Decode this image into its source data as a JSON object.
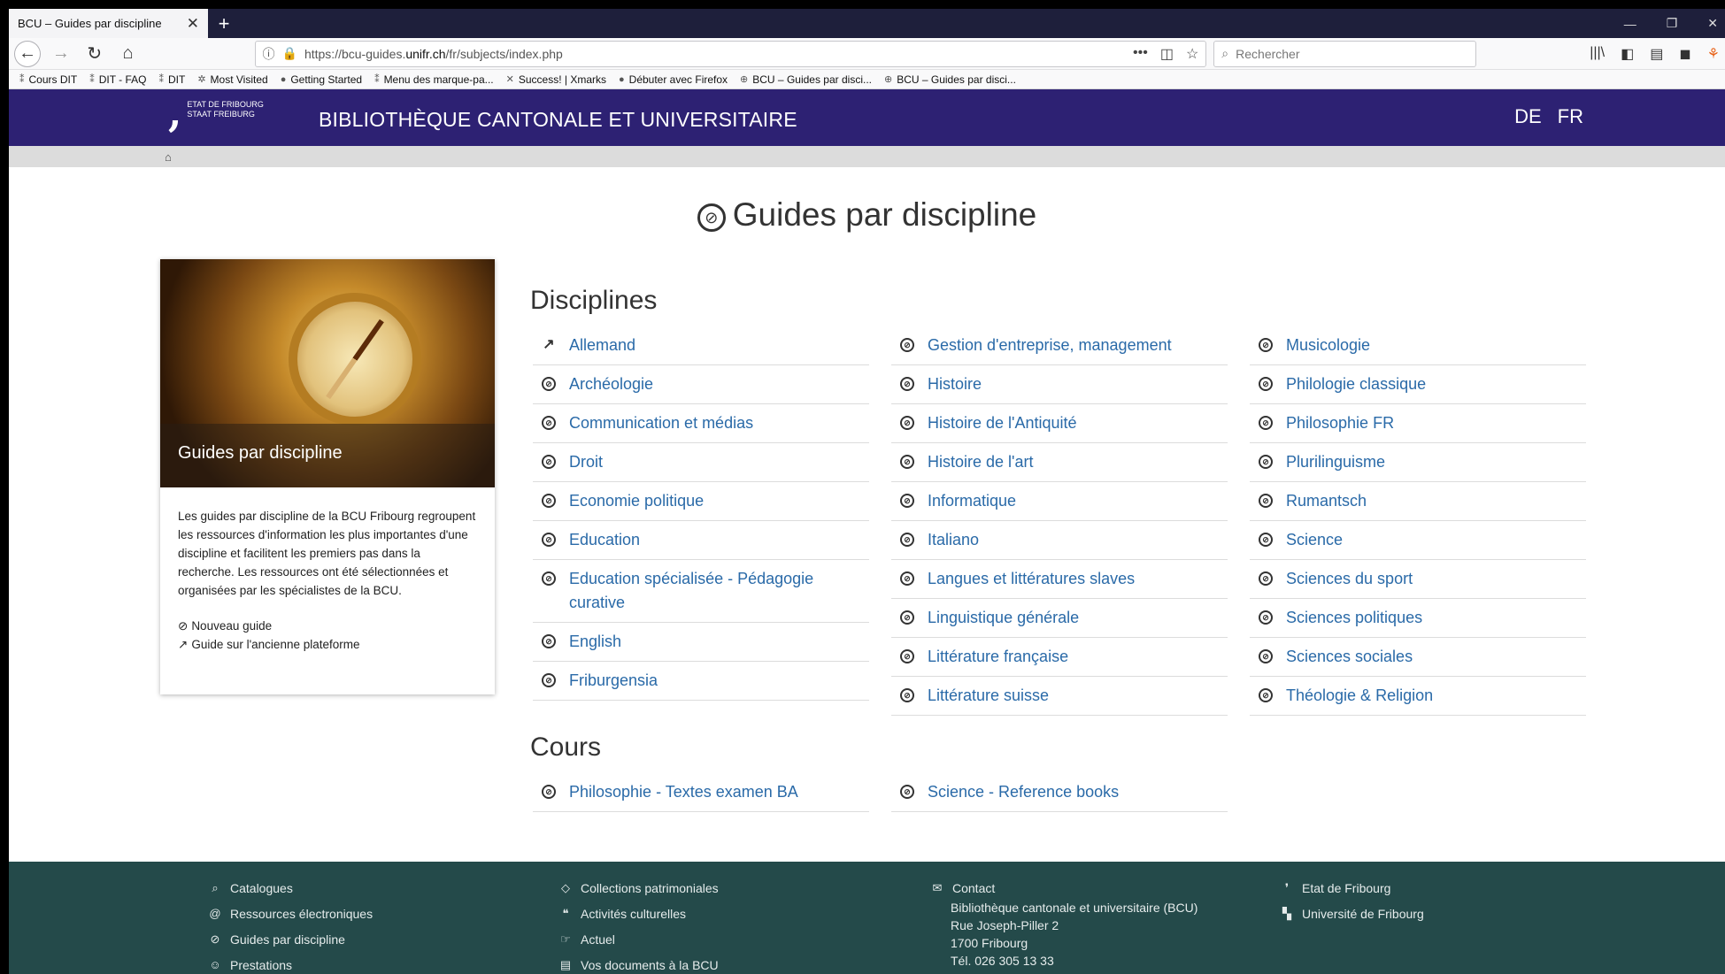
{
  "browser": {
    "tab_title": "BCU – Guides par discipline",
    "url_prefix": "https://bcu-guides.",
    "url_domain": "unifr.ch",
    "url_path": "/fr/subjects/index.php",
    "search_placeholder": "Rechercher",
    "bookmarks": [
      {
        "label": "Cours DIT",
        "icon": "folder-icon"
      },
      {
        "label": "DIT - FAQ",
        "icon": "folder-icon"
      },
      {
        "label": "DIT",
        "icon": "folder-icon"
      },
      {
        "label": "Most Visited",
        "icon": "gear-icon"
      },
      {
        "label": "Getting Started",
        "icon": "firefox-icon"
      },
      {
        "label": "Menu des marque-pa...",
        "icon": "folder-icon"
      },
      {
        "label": "Success! | Xmarks",
        "icon": "xmarks-icon"
      },
      {
        "label": "Débuter avec Firefox",
        "icon": "firefox-icon"
      },
      {
        "label": "BCU – Guides par disci...",
        "icon": "globe-icon"
      },
      {
        "label": "BCU – Guides par disci...",
        "icon": "globe-icon"
      }
    ]
  },
  "header": {
    "logo_line1": "ETAT DE FRIBOURG",
    "logo_line2": "STAAT FREIBURG",
    "title": "BIBLIOTHÈQUE CANTONALE ET UNIVERSITAIRE",
    "lang_de": "DE",
    "lang_fr": "FR"
  },
  "page": {
    "title": "Guides par discipline"
  },
  "card": {
    "image_caption": "Guides par discipline",
    "description": "Les guides par discipline de la BCU Fribourg regroupent les ressources d'information les plus importantes d'une discipline et facilitent les premiers pas dans la recherche. Les ressources ont été sélectionnées et organisées par les spécialistes de la BCU.",
    "new_guide": "Nouveau guide",
    "old_guide": "Guide sur l'ancienne plateforme"
  },
  "disciplines": {
    "heading": "Disciplines",
    "col1": [
      "Allemand",
      "Archéologie",
      "Communication et médias",
      "Droit",
      "Economie politique",
      "Education",
      "Education spécialisée - Pédagogie curative",
      "English",
      "Friburgensia"
    ],
    "col2": [
      "Gestion d'entreprise, management",
      "Histoire",
      "Histoire de l'Antiquité",
      "Histoire de l'art",
      "Informatique",
      "Italiano",
      "Langues et littératures slaves",
      "Linguistique générale",
      "Littérature française",
      "Littérature suisse"
    ],
    "col3": [
      "Musicologie",
      "Philologie classique",
      "Philosophie FR",
      "Plurilinguisme",
      "Rumantsch",
      "Science",
      "Sciences du sport",
      "Sciences politiques",
      "Sciences sociales",
      "Théologie & Religion"
    ]
  },
  "cours": {
    "heading": "Cours",
    "col1": [
      "Philosophie - Textes examen BA"
    ],
    "col2": [
      "Science - Reference books"
    ]
  },
  "footer": {
    "col1": [
      "Catalogues",
      "Ressources électroniques",
      "Guides par discipline",
      "Prestations"
    ],
    "col2": [
      "Collections patrimoniales",
      "Activités culturelles",
      "Actuel",
      "Vos documents à la BCU"
    ],
    "contact": "Contact",
    "address": [
      "Bibliothèque cantonale et universitaire (BCU)",
      "Rue Joseph-Piller 2",
      "1700 Fribourg",
      "Tél. 026 305 13 33"
    ],
    "col4": [
      "Etat de Fribourg",
      "Université de Fribourg"
    ]
  }
}
